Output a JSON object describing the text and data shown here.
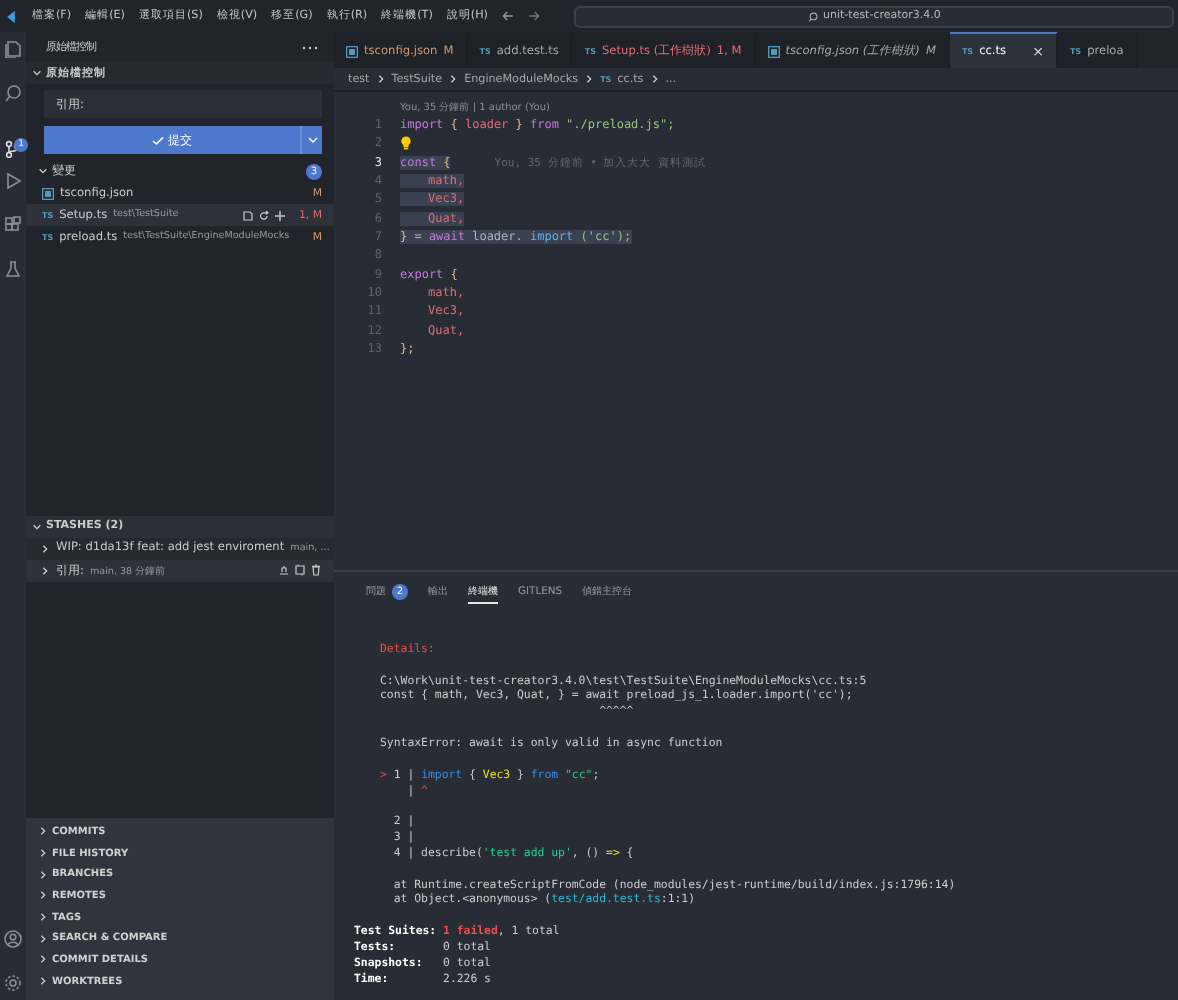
{
  "menu": [
    "檔案(F)",
    "編輯(E)",
    "選取項目(S)",
    "檢視(V)",
    "移至(G)",
    "執行(R)",
    "終端機(T)",
    "說明(H)"
  ],
  "title_search": "unit-test-creator3.4.0",
  "activity_badge": "1",
  "sidebar": {
    "title": "原始檔控制",
    "section": "原始檔控制",
    "message_placeholder": "引用:",
    "commit_label": "提交",
    "changes": {
      "label": "變更",
      "count": "3",
      "files": [
        {
          "kind": "json",
          "name": "tsconfig.json",
          "status": "M",
          "error": false,
          "selected": false
        },
        {
          "kind": "ts",
          "badge": "TS",
          "name": "Setup.ts",
          "path": "test\\TestSuite",
          "status": "1, M",
          "error": true,
          "selected": true
        },
        {
          "kind": "ts",
          "badge": "TS",
          "name": "preload.ts",
          "path": "test\\TestSuite\\EngineModuleMocks",
          "status": "M",
          "error": false,
          "selected": false
        }
      ]
    },
    "stashes": {
      "title": "STASHES (2)",
      "expanded": true,
      "items": [
        {
          "label": "WIP: d1da13f feat: add jest enviroment",
          "detail": "main, …",
          "selected": false
        },
        {
          "label": "引用:",
          "detail": "main, 38 分鐘前",
          "selected": true
        }
      ]
    },
    "sections": [
      {
        "label": "COMMITS",
        "expanded": false
      },
      {
        "label": "FILE HISTORY",
        "expanded": false
      },
      {
        "label": "BRANCHES",
        "expanded": false
      },
      {
        "label": "REMOTES",
        "expanded": false
      },
      {
        "label": "TAGS",
        "expanded": false
      },
      {
        "label": "SEARCH & COMPARE",
        "expanded": false
      },
      {
        "label": "COMMIT DETAILS",
        "expanded": false
      },
      {
        "label": "WORKTREES",
        "expanded": false
      }
    ]
  },
  "tabs": [
    {
      "kind": "json",
      "label": "tsconfig.json",
      "status": "M",
      "modified": true,
      "error": false,
      "preview": false,
      "selected": false
    },
    {
      "kind": "ts",
      "badge": "TS",
      "label": "add.test.ts",
      "modified": false,
      "error": false,
      "preview": false,
      "selected": false
    },
    {
      "kind": "ts",
      "badge": "TS",
      "label": "Setup.ts (工作樹狀)",
      "status": "1, M",
      "modified": true,
      "error": true,
      "preview": false,
      "selected": false
    },
    {
      "kind": "json",
      "label": "tsconfig.json (工作樹狀)",
      "status": "M",
      "modified": false,
      "error": false,
      "preview": true,
      "selected": false
    },
    {
      "kind": "ts",
      "badge": "TS",
      "label": "cc.ts",
      "close": "×",
      "modified": false,
      "error": false,
      "preview": false,
      "selected": true
    },
    {
      "kind": "ts",
      "badge": "TS",
      "label": "preloa",
      "modified": false,
      "error": false,
      "preview": false,
      "selected": false
    }
  ],
  "breadcrumb": [
    {
      "text": "test"
    },
    {
      "text": "TestSuite"
    },
    {
      "text": "EngineModuleMocks"
    },
    {
      "text": "cc.ts",
      "badge": "TS"
    },
    {
      "text": "..."
    }
  ],
  "editor": {
    "codelens": "You, 35 分鐘前 | 1 author (You)",
    "lines": [
      {
        "number": "1",
        "current": false,
        "highlighted": false,
        "tokens": [
          {
            "t": "import",
            "kind": "keyword"
          },
          {
            "t": "{",
            "kind": "bracket"
          },
          {
            "t": "loader",
            "kind": "variable"
          },
          {
            "t": "}",
            "kind": "bracket"
          },
          {
            "t": "from",
            "kind": "keyword"
          },
          {
            "t": "\"./preload.js\";",
            "kind": "string"
          }
        ]
      },
      {
        "number": "2",
        "current": false,
        "lightbulb": true
      },
      {
        "number": "3",
        "current": true,
        "highlighted": true,
        "blame": "You, 35 分鐘前 • 加入大大 資料測試",
        "tokens": [
          {
            "t": "const",
            "kind": "keyword"
          },
          {
            "t": "{",
            "kind": "bracket"
          }
        ]
      },
      {
        "number": "4",
        "current": false,
        "highlighted": true,
        "indent": true,
        "tokens": [
          {
            "t": "math,",
            "kind": "variable"
          }
        ]
      },
      {
        "number": "5",
        "current": false,
        "highlighted": true,
        "indent": true,
        "tokens": [
          {
            "t": "Vec3,",
            "kind": "variable"
          }
        ]
      },
      {
        "number": "6",
        "current": false,
        "highlighted": true,
        "indent": true,
        "tokens": [
          {
            "t": "Quat,",
            "kind": "variable"
          }
        ]
      },
      {
        "number": "7",
        "current": false,
        "highlighted": true,
        "tokens": [
          {
            "t": "}",
            "kind": "bracket"
          },
          {
            "t": "=",
            "kind": "plain"
          },
          {
            "t": "await",
            "kind": "keyword"
          },
          {
            "t": "loader.",
            "kind": "plain"
          },
          {
            "t": "import",
            "kind": "function"
          },
          {
            "t": "('cc');",
            "kind": "string"
          }
        ]
      },
      {
        "number": "8",
        "current": false
      },
      {
        "number": "9",
        "current": false,
        "highlighted": false,
        "tokens": [
          {
            "t": "export",
            "kind": "keyword"
          },
          {
            "t": "{",
            "kind": "bracket"
          }
        ]
      },
      {
        "number": "10",
        "current": false,
        "highlighted": false,
        "indent": true,
        "tokens": [
          {
            "t": "math,",
            "kind": "variable"
          }
        ]
      },
      {
        "number": "11",
        "current": false,
        "highlighted": false,
        "indent": true,
        "tokens": [
          {
            "t": "Vec3,",
            "kind": "variable"
          }
        ]
      },
      {
        "number": "12",
        "current": false,
        "highlighted": false,
        "indent": true,
        "tokens": [
          {
            "t": "Quat,",
            "kind": "variable"
          }
        ]
      },
      {
        "number": "13",
        "current": false,
        "highlighted": false,
        "tokens": [
          {
            "t": "};",
            "kind": "bracket"
          }
        ]
      }
    ]
  },
  "panel": {
    "tabs": [
      {
        "label": "問題",
        "count": "2",
        "selected": false
      },
      {
        "label": "輸出",
        "selected": false
      },
      {
        "label": "終端機",
        "selected": true
      },
      {
        "label": "GITLENS",
        "selected": false
      },
      {
        "label": "偵錯主控台",
        "selected": false
      }
    ],
    "terminal": [
      {
        "indent": true,
        "segments": [
          {
            "t": "Details:",
            "kind": "red"
          }
        ]
      },
      {
        "kind": "blank"
      },
      {
        "indent": true,
        "segments": [
          {
            "t": "C:\\Work\\unit-test-creator3.4.0\\test\\TestSuite\\EngineModuleMocks\\cc.ts:5",
            "kind": "plain"
          }
        ]
      },
      {
        "indent": true,
        "segments": [
          {
            "t": "const { math, Vec3, Quat, } = await preload_js_1.loader.import('cc');",
            "kind": "plain"
          }
        ]
      },
      {
        "indent": true,
        "segments": [
          {
            "t": "                                ^^^^^",
            "kind": "plain"
          }
        ]
      },
      {
        "kind": "blank"
      },
      {
        "indent": true,
        "segments": [
          {
            "t": "SyntaxError: await is only valid in async function",
            "kind": "plain"
          }
        ]
      },
      {
        "kind": "blank"
      },
      {
        "indent": true,
        "segments": [
          {
            "t": ">",
            "kind": "red"
          },
          {
            "t": " 1 | ",
            "kind": "plain"
          },
          {
            "t": "import",
            "kind": "blue"
          },
          {
            "t": " { ",
            "kind": "plain"
          },
          {
            "t": "Vec3",
            "kind": "yellow"
          },
          {
            "t": " } ",
            "kind": "plain"
          },
          {
            "t": "from",
            "kind": "blue"
          },
          {
            "t": " \"cc\"",
            "kind": "green"
          },
          {
            "t": ";",
            "kind": "plain"
          }
        ]
      },
      {
        "indent": true,
        "segments": [
          {
            "t": "    | ",
            "kind": "plain"
          },
          {
            "t": "^",
            "kind": "red"
          }
        ]
      },
      {
        "kind": "blank"
      },
      {
        "indent": true,
        "segments": [
          {
            "t": "  2 |",
            "kind": "plain"
          }
        ]
      },
      {
        "indent": true,
        "segments": [
          {
            "t": "  3 |",
            "kind": "plain"
          }
        ]
      },
      {
        "indent": true,
        "segments": [
          {
            "t": "  4 | describe(",
            "kind": "plain"
          },
          {
            "t": "'test add up'",
            "kind": "green"
          },
          {
            "t": ", () ",
            "kind": "plain"
          },
          {
            "t": "=>",
            "kind": "yellow"
          },
          {
            "t": " {",
            "kind": "plain"
          }
        ]
      },
      {
        "kind": "blank"
      },
      {
        "indent": true,
        "segments": [
          {
            "t": "  at Runtime.createScriptFromCode (node_modules/jest-runtime/build/index.js:1796:14)",
            "kind": "plain"
          }
        ]
      },
      {
        "indent": true,
        "segments": [
          {
            "t": "  at Object.<anonymous> (",
            "kind": "plain"
          },
          {
            "t": "test/add.test.ts",
            "kind": "cyan"
          },
          {
            "t": ":1:1)",
            "kind": "plain"
          }
        ]
      },
      {
        "kind": "blank"
      },
      {
        "indent": false,
        "segments": [
          {
            "t": "Test Suites: ",
            "kind": "bold"
          },
          {
            "t": "1 failed",
            "kind": "redbold"
          },
          {
            "t": ", 1 total",
            "kind": "plain"
          }
        ]
      },
      {
        "indent": false,
        "segments": [
          {
            "t": "Tests:       ",
            "kind": "bold"
          },
          {
            "t": "0 total",
            "kind": "plain"
          }
        ]
      },
      {
        "indent": false,
        "segments": [
          {
            "t": "Snapshots:   ",
            "kind": "bold"
          },
          {
            "t": "0 total",
            "kind": "plain"
          }
        ]
      },
      {
        "indent": false,
        "segments": [
          {
            "t": "Time:        ",
            "kind": "bold"
          },
          {
            "t": "2.226 s",
            "kind": "plain"
          }
        ]
      }
    ]
  }
}
